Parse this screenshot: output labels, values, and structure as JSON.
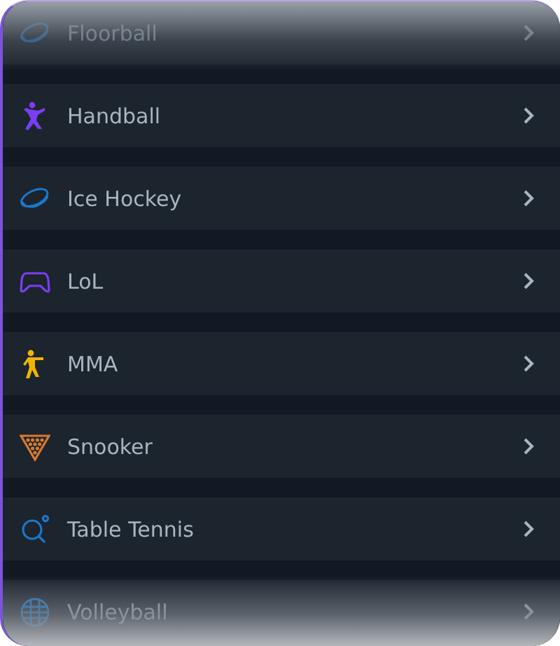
{
  "sports": [
    {
      "label": "Floorball",
      "kind": "puck"
    },
    {
      "label": "Handball",
      "kind": "player"
    },
    {
      "label": "Ice Hockey",
      "kind": "puck"
    },
    {
      "label": "LoL",
      "kind": "gamepad"
    },
    {
      "label": "MMA",
      "kind": "fighter"
    },
    {
      "label": "Snooker",
      "kind": "rack"
    },
    {
      "label": "Table Tennis",
      "kind": "paddle"
    },
    {
      "label": "Volleyball",
      "kind": "ball"
    }
  ]
}
